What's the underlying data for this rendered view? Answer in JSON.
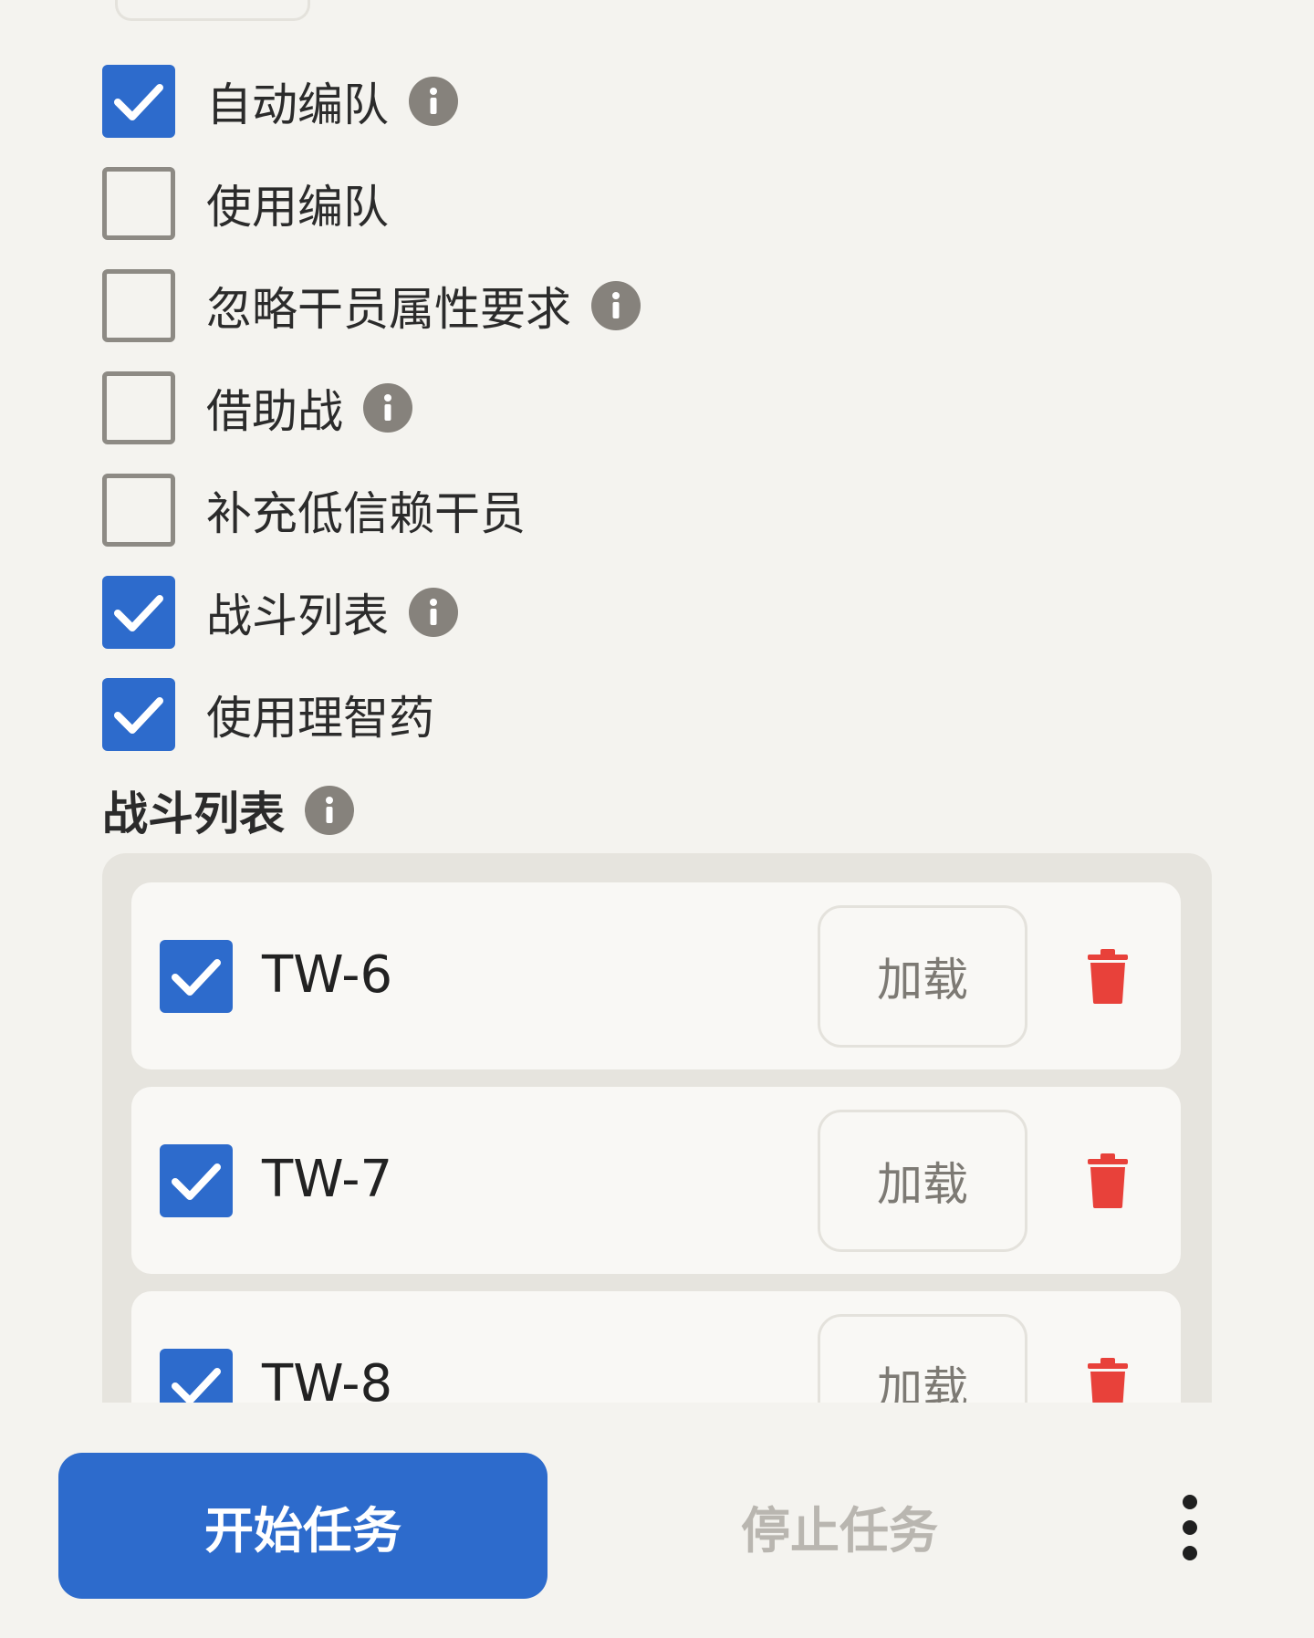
{
  "options": [
    {
      "label": "自动编队",
      "checked": true,
      "info": true
    },
    {
      "label": "使用编队",
      "checked": false,
      "info": false
    },
    {
      "label": "忽略干员属性要求",
      "checked": false,
      "info": true
    },
    {
      "label": "借助战",
      "checked": false,
      "info": true
    },
    {
      "label": "补充低信赖干员",
      "checked": false,
      "info": false
    },
    {
      "label": "战斗列表",
      "checked": true,
      "info": true
    },
    {
      "label": "使用理智药",
      "checked": true,
      "info": false
    }
  ],
  "section": {
    "title": "战斗列表"
  },
  "battle_list": [
    {
      "name": "TW-6",
      "checked": true,
      "load_label": "加载"
    },
    {
      "name": "TW-7",
      "checked": true,
      "load_label": "加载"
    },
    {
      "name": "TW-8",
      "checked": true,
      "load_label": "加载"
    }
  ],
  "footer": {
    "start_label": "开始任务",
    "stop_label": "停止任务"
  },
  "icons": {
    "info": "info-icon",
    "check": "check-icon",
    "delete": "trash-icon",
    "more": "more-vertical-icon"
  },
  "colors": {
    "accent": "#2d6bcc",
    "delete": "#e8413a",
    "background": "#f4f3ef"
  }
}
